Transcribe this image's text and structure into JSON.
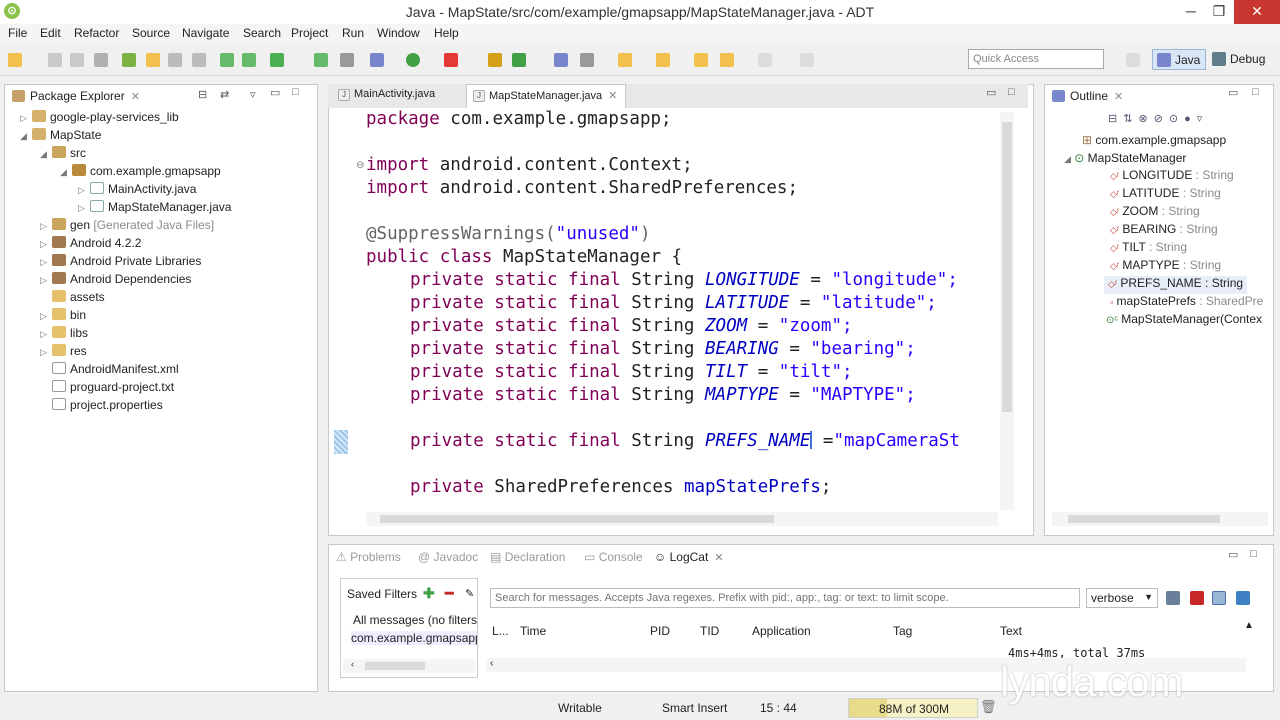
{
  "window": {
    "title": "Java - MapState/src/com/example/gmapsapp/MapStateManager.java - ADT",
    "minimize": "─",
    "restore": "❐",
    "close": "✕"
  },
  "menu": [
    "File",
    "Edit",
    "Refactor",
    "Source",
    "Navigate",
    "Search",
    "Project",
    "Run",
    "Window",
    "Help"
  ],
  "toolbar": {
    "quick_access": "Quick Access",
    "perspective_java": "Java",
    "perspective_debug": "Debug"
  },
  "package_explorer": {
    "title": "Package Explorer",
    "items": [
      {
        "label": "google-play-services_lib",
        "suffix": ""
      },
      {
        "label": "MapState",
        "suffix": ""
      },
      {
        "label": "src",
        "suffix": ""
      },
      {
        "label": "com.example.gmapsapp",
        "suffix": ""
      },
      {
        "label": "MainActivity.java",
        "suffix": ""
      },
      {
        "label": "MapStateManager.java",
        "suffix": ""
      },
      {
        "label": "gen",
        "suffix": "[Generated Java Files]"
      },
      {
        "label": "Android 4.2.2",
        "suffix": ""
      },
      {
        "label": "Android Private Libraries",
        "suffix": ""
      },
      {
        "label": "Android Dependencies",
        "suffix": ""
      },
      {
        "label": "assets",
        "suffix": ""
      },
      {
        "label": "bin",
        "suffix": ""
      },
      {
        "label": "libs",
        "suffix": ""
      },
      {
        "label": "res",
        "suffix": ""
      },
      {
        "label": "AndroidManifest.xml",
        "suffix": ""
      },
      {
        "label": "proguard-project.txt",
        "suffix": ""
      },
      {
        "label": "project.properties",
        "suffix": ""
      }
    ]
  },
  "editor": {
    "tabs": [
      "MainActivity.java",
      "MapStateManager.java"
    ],
    "active_tab": "MapStateManager.java",
    "code": {
      "package_kw": "package",
      "package_name": " com.example.gmapsapp;",
      "import_kw": "import",
      "import1": " android.content.Context;",
      "import2": " android.content.SharedPreferences;",
      "annotation": "@SuppressWarnings(",
      "annotation_val": "\"unused\"",
      "annotation_end": ")",
      "class_decl_kw": "public class",
      "class_decl_rest": " MapStateManager {",
      "psf": "private static final",
      "string_type": " String ",
      "fields": [
        {
          "name": "LONGITUDE",
          "value": "\"longitude\";"
        },
        {
          "name": "LATITUDE",
          "value": "\"latitude\";"
        },
        {
          "name": "ZOOM",
          "value": "\"zoom\";"
        },
        {
          "name": "BEARING",
          "value": "\"bearing\";"
        },
        {
          "name": "TILT",
          "value": "\"tilt\";"
        },
        {
          "name": "MAPTYPE",
          "value": "\"MAPTYPE\";"
        }
      ],
      "prefs_name": "PREFS_NAME",
      "prefs_value": "\"mapCameraSt",
      "eq": " = ",
      "private_kw": "private",
      "shared_prefs_line": " SharedPreferences ",
      "shared_prefs_field": "mapStatePrefs",
      "semi": ";"
    }
  },
  "outline": {
    "title": "Outline",
    "package": "com.example.gmapsapp",
    "class": "MapStateManager",
    "members": [
      {
        "name": "LONGITUDE",
        "type": " : String"
      },
      {
        "name": "LATITUDE",
        "type": " : String"
      },
      {
        "name": "ZOOM",
        "type": " : String"
      },
      {
        "name": "BEARING",
        "type": " : String"
      },
      {
        "name": "TILT",
        "type": " : String"
      },
      {
        "name": "MAPTYPE",
        "type": " : String"
      },
      {
        "name": "PREFS_NAME",
        "type": " : String"
      },
      {
        "name": "mapStatePrefs",
        "type": " : SharedPre"
      },
      {
        "name": "MapStateManager(Contex",
        "type": ""
      }
    ]
  },
  "bottom": {
    "tabs": [
      "Problems",
      "Javadoc",
      "Declaration",
      "Console",
      "LogCat"
    ],
    "active_tab": "LogCat",
    "saved_filters": "Saved Filters",
    "filters": [
      "All messages (no filters)",
      "com.example.gmapsapp"
    ],
    "search_placeholder": "Search for messages. Accepts Java regexes. Prefix with pid:, app:, tag: or text: to limit scope.",
    "level": "verbose",
    "columns": [
      "L...",
      "Time",
      "PID",
      "TID",
      "Application",
      "Tag",
      "Text"
    ],
    "log_text": "4ms+4ms, total 37ms"
  },
  "status": {
    "writable": "Writable",
    "insert_mode": "Smart Insert",
    "position": "15 : 44",
    "heap": "88M of 300M",
    "heap_used_fraction": 0.293
  },
  "watermark": "lynda.com",
  "colors": {
    "keyword": "#7f0055",
    "string": "#2a00ff",
    "field": "#0000c0",
    "annotation": "#646464"
  }
}
